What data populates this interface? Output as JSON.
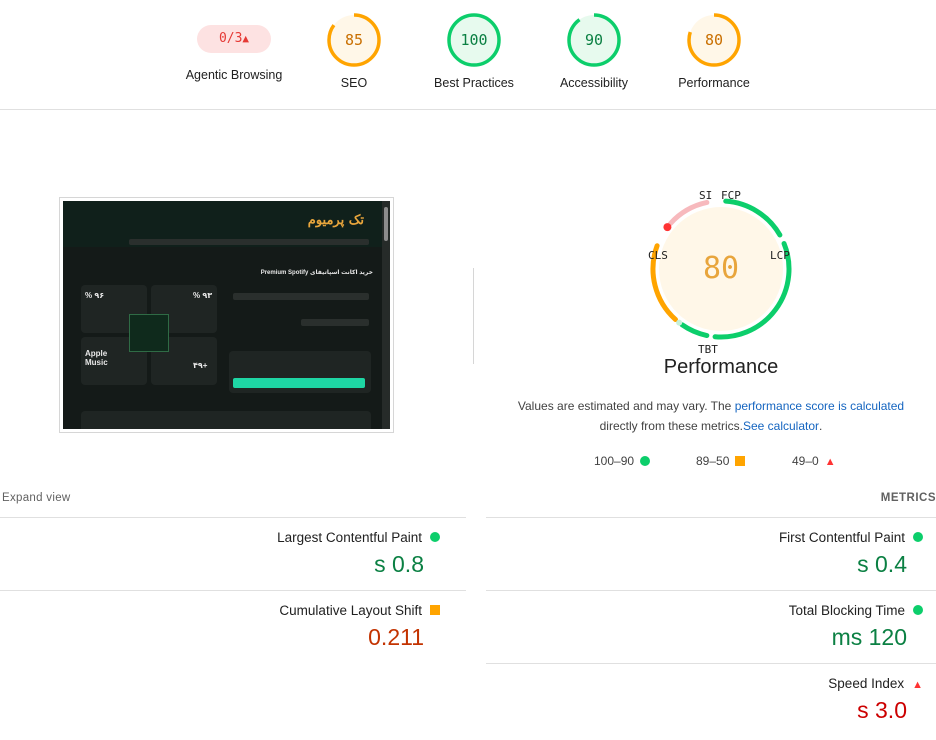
{
  "categories": [
    {
      "label": "Agentic Browsing",
      "score": "0/3",
      "type": "pill"
    },
    {
      "label": "SEO",
      "score": "85",
      "fraction": 0.85,
      "color": "#ffa400",
      "bg": "#fff7e8",
      "text": "#c96f00"
    },
    {
      "label": "Best Practices",
      "score": "100",
      "fraction": 1.0,
      "color": "#0cce6b",
      "bg": "#e7faee",
      "text": "#0b8043"
    },
    {
      "label": "Accessibility",
      "score": "90",
      "fraction": 0.9,
      "color": "#0cce6b",
      "bg": "#e7faee",
      "text": "#0b8043"
    },
    {
      "label": "Performance",
      "score": "80",
      "fraction": 0.8,
      "color": "#ffa400",
      "bg": "#fff7e8",
      "text": "#c96f00"
    }
  ],
  "thumbnail": {
    "logo_text": "تک پرمیوم",
    "promo_heading": "Premium Spotify خرید اکانت اسپاتیفای",
    "stat_1": "% ۹۳",
    "stat_2": "% ۹۶",
    "stat_3": "۴۹+",
    "stat_4": "Apple Music"
  },
  "performance": {
    "score": "80",
    "title": "Performance",
    "metric_labels": [
      "SI",
      "FCP",
      "LCP",
      "TBT",
      "CLS"
    ],
    "colors": {
      "good": "#0cce6b",
      "average": "#ffa400",
      "fail": "#ff3333"
    }
  },
  "note": {
    "text_1": "Values are estimated and may vary. The",
    "link_1": "performance score is calculated",
    "text_2": ".directly from these metrics.",
    "link_2": "See calculator"
  },
  "legend": {
    "good": "100–90",
    "average": "89–50",
    "fail": "49–0"
  },
  "metrics_section": {
    "expand_label": "Expand view",
    "header": "METRICS",
    "items": [
      {
        "name": "First Contentful Paint",
        "value": "s 0.4",
        "rating": "good"
      },
      {
        "name": "Largest Contentful Paint",
        "value": "s 0.8",
        "rating": "good"
      },
      {
        "name": "Total Blocking Time",
        "value": "ms 120",
        "rating": "good"
      },
      {
        "name": "Cumulative Layout Shift",
        "value": "0.211",
        "rating": "average"
      },
      {
        "name": "Speed Index",
        "value": "s 3.0",
        "rating": "fail"
      }
    ]
  }
}
